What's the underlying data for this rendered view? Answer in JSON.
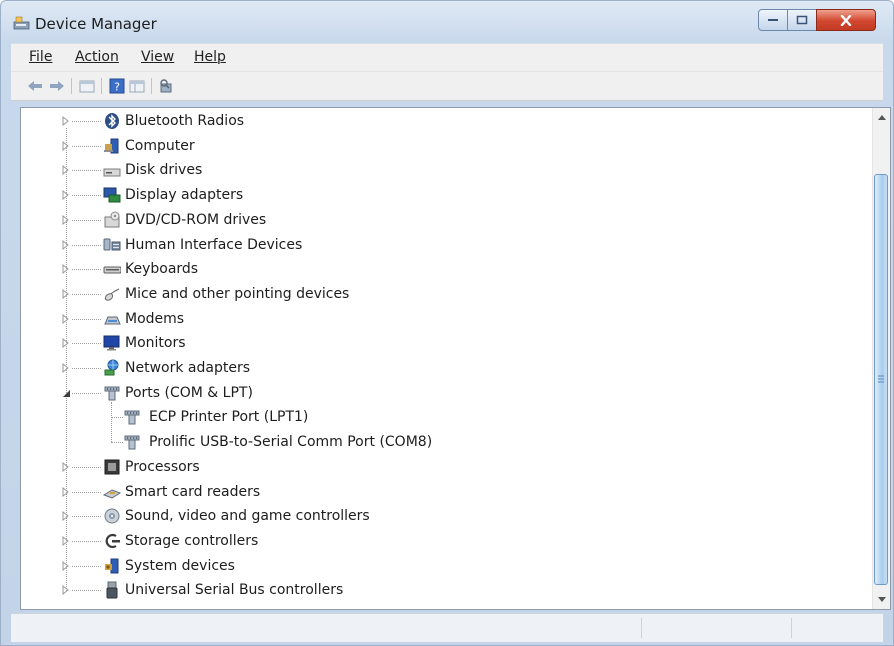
{
  "window": {
    "title": "Device Manager",
    "close_color": "#c9432b"
  },
  "menu": [
    {
      "label": "File"
    },
    {
      "label": "Action"
    },
    {
      "label": "View"
    },
    {
      "label": "Help"
    }
  ],
  "toolbar": {
    "icons": [
      "back-arrow-icon",
      "forward-arrow-icon",
      "properties-icon",
      "help-icon",
      "details-pane-icon",
      "scan-hardware-icon"
    ]
  },
  "tree": {
    "categories": [
      {
        "label": "Bluetooth Radios",
        "icon": "bluetooth-icon",
        "expanded": false
      },
      {
        "label": "Computer",
        "icon": "computer-icon",
        "expanded": false
      },
      {
        "label": "Disk drives",
        "icon": "disk-drive-icon",
        "expanded": false
      },
      {
        "label": "Display adapters",
        "icon": "display-adapter-icon",
        "expanded": false
      },
      {
        "label": "DVD/CD-ROM drives",
        "icon": "dvd-drive-icon",
        "expanded": false
      },
      {
        "label": "Human Interface Devices",
        "icon": "hid-icon",
        "expanded": false
      },
      {
        "label": "Keyboards",
        "icon": "keyboard-icon",
        "expanded": false
      },
      {
        "label": "Mice and other pointing devices",
        "icon": "mouse-icon",
        "expanded": false
      },
      {
        "label": "Modems",
        "icon": "modem-icon",
        "expanded": false
      },
      {
        "label": "Monitors",
        "icon": "monitor-icon",
        "expanded": false
      },
      {
        "label": "Network adapters",
        "icon": "network-adapter-icon",
        "expanded": false
      },
      {
        "label": "Ports (COM & LPT)",
        "icon": "port-icon",
        "expanded": true,
        "children": [
          {
            "label": "ECP Printer Port (LPT1)",
            "icon": "port-icon"
          },
          {
            "label": "Prolific USB-to-Serial Comm Port (COM8)",
            "icon": "port-icon"
          }
        ]
      },
      {
        "label": "Processors",
        "icon": "processor-icon",
        "expanded": false
      },
      {
        "label": "Smart card readers",
        "icon": "smart-card-reader-icon",
        "expanded": false
      },
      {
        "label": "Sound, video and game controllers",
        "icon": "sound-icon",
        "expanded": false
      },
      {
        "label": "Storage controllers",
        "icon": "storage-controller-icon",
        "expanded": false
      },
      {
        "label": "System devices",
        "icon": "system-devices-icon",
        "expanded": false
      },
      {
        "label": "Universal Serial Bus controllers",
        "icon": "usb-icon",
        "expanded": false
      }
    ]
  }
}
